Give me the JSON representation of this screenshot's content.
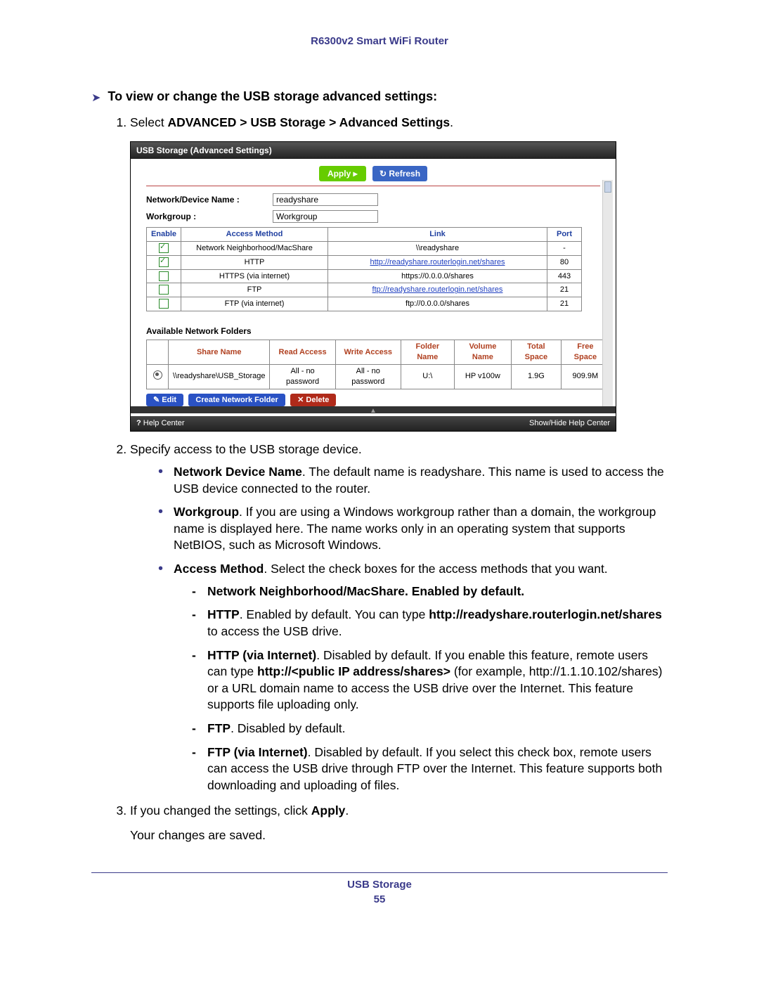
{
  "header": {
    "title": "R6300v2 Smart WiFi Router"
  },
  "intro": {
    "arrow": "➤",
    "text": "To view or change the USB storage advanced settings:"
  },
  "step1": {
    "prefix": "Select ",
    "bold": "ADVANCED > USB Storage > Advanced Settings",
    "suffix": "."
  },
  "screenshot": {
    "title": "USB Storage (Advanced Settings)",
    "apply": "Apply ▸",
    "refresh": "↻ Refresh",
    "netdev_label": "Network/Device Name :",
    "netdev_value": "readyshare",
    "workgroup_label": "Workgroup :",
    "workgroup_value": "Workgroup",
    "acc_headers": {
      "enable": "Enable",
      "method": "Access Method",
      "link": "Link",
      "port": "Port"
    },
    "acc_rows": [
      {
        "enabled": true,
        "method": "Network Neighborhood/MacShare",
        "link": "\\\\readyshare",
        "link_is_link": false,
        "port": "-"
      },
      {
        "enabled": true,
        "method": "HTTP",
        "link": "http://readyshare.routerlogin.net/shares",
        "link_is_link": true,
        "port": "80"
      },
      {
        "enabled": false,
        "method": "HTTPS (via internet)",
        "link": "https://0.0.0.0/shares",
        "link_is_link": false,
        "port": "443"
      },
      {
        "enabled": false,
        "method": "FTP",
        "link": "ftp://readyshare.routerlogin.net/shares",
        "link_is_link": true,
        "port": "21"
      },
      {
        "enabled": false,
        "method": "FTP (via internet)",
        "link": "ftp://0.0.0.0/shares",
        "link_is_link": false,
        "port": "21"
      }
    ],
    "folders_title": "Available Network Folders",
    "fold_headers": {
      "share": "Share Name",
      "read": "Read Access",
      "write": "Write Access",
      "folder": "Folder Name",
      "vol": "Volume Name",
      "total": "Total Space",
      "free": "Free Space"
    },
    "fold_rows": [
      {
        "selected": true,
        "share": "\\\\readyshare\\USB_Storage",
        "read": "All - no password",
        "write": "All - no password",
        "folder": "U:\\",
        "vol": "HP v100w",
        "total": "1.9G",
        "free": "909.9M"
      }
    ],
    "btn_edit": "✎ Edit",
    "btn_create": "Create Network Folder",
    "btn_delete": "✕ Delete",
    "help_center": "Help Center",
    "showhide": "Show/Hide Help Center"
  },
  "step2": {
    "text": "Specify access to the USB storage device.",
    "b1_bold": "Network Device Name",
    "b1_rest": ". The default name is readyshare. This name is used to access the USB device connected to the router.",
    "b2_bold": "Workgroup",
    "b2_rest": ". If you are using a Windows workgroup rather than a domain, the workgroup name is displayed here. The name works only in an operating system that supports NetBIOS, such as Microsoft Windows.",
    "b3_bold": "Access Method",
    "b3_rest": ". Select the check boxes for the access methods that you want.",
    "d1": "Network Neighborhood/MacShare. Enabled by default.",
    "d2_bold": "HTTP",
    "d2_mid": ". Enabled by default. You can type ",
    "d2_url": "http://readyshare.routerlogin.net/shares",
    "d2_end": " to access the USB drive.",
    "d3_bold": "HTTP (via Internet)",
    "d3_a": ". Disabled by default. If you enable this feature, remote users can type ",
    "d3_b": "http://<public IP address/shares>",
    "d3_c": " (for example, http://1.1.10.102/shares) or a URL domain name to access the USB drive over the Internet. This feature supports file uploading only.",
    "d4_bold": "FTP",
    "d4_rest": ". Disabled by default.",
    "d5_bold": "FTP (via Internet)",
    "d5_rest": ". Disabled by default. If you select this check box, remote users can access the USB drive through FTP over the Internet. This feature supports both downloading and uploading of files."
  },
  "step3": {
    "a": "If you changed the settings, click ",
    "b": "Apply",
    "c": ".",
    "result": "Your changes are saved."
  },
  "footer": {
    "section": "USB Storage",
    "page": "55"
  }
}
